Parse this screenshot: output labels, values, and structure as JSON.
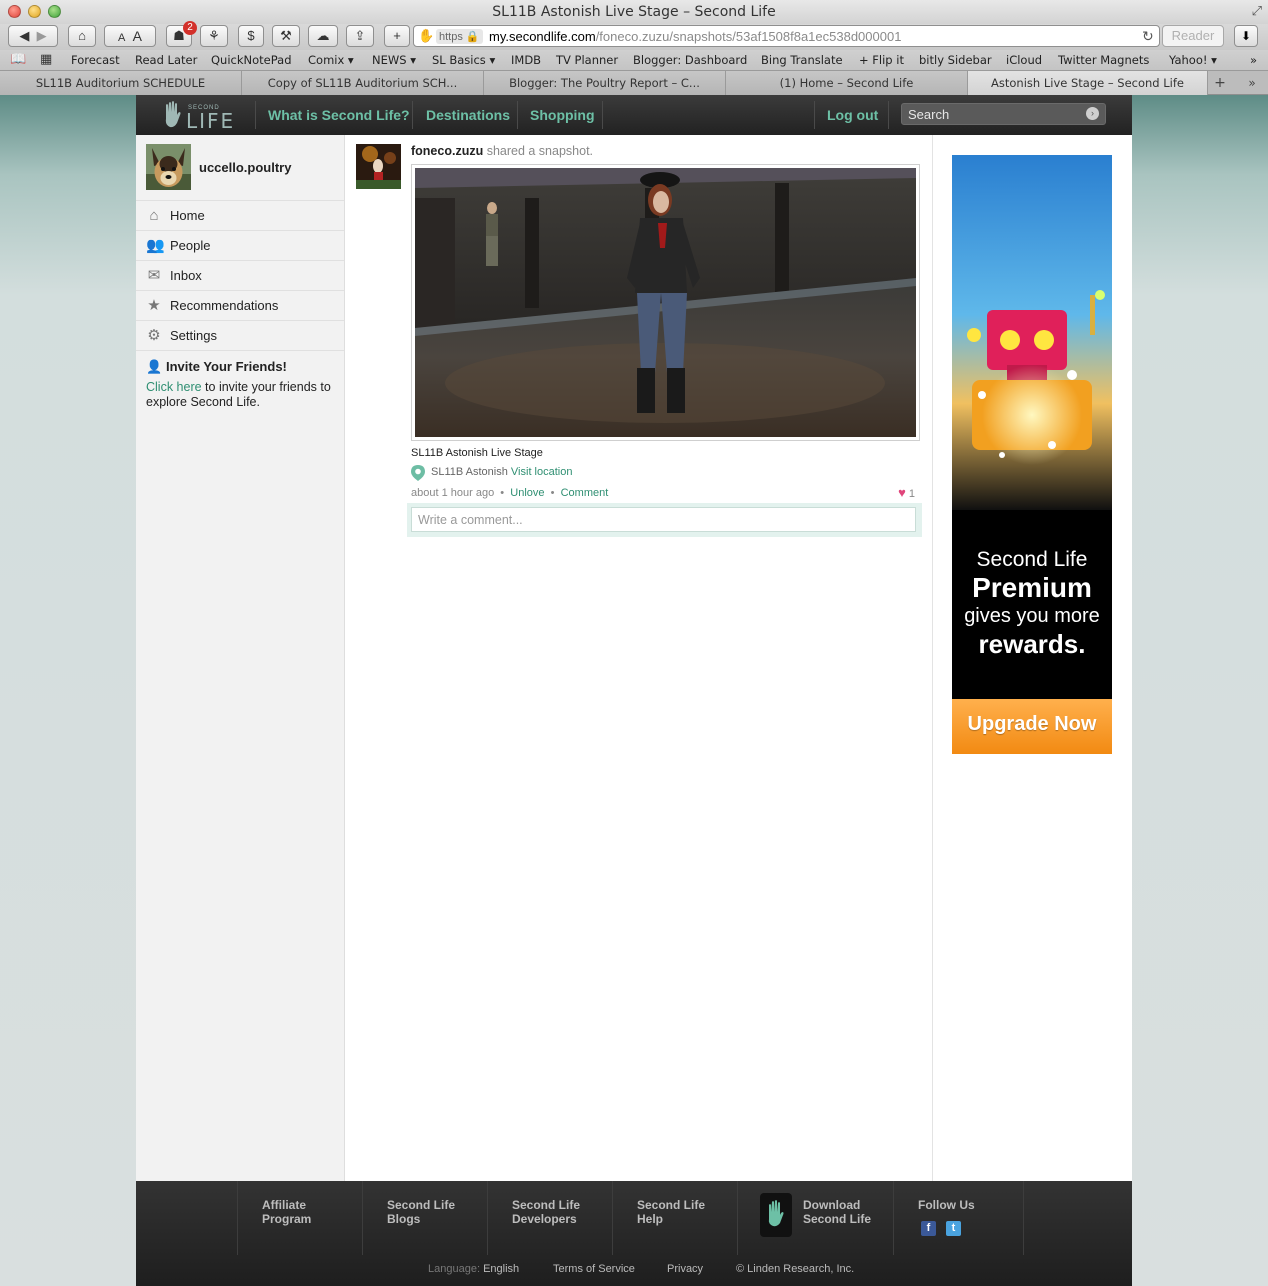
{
  "window": {
    "title": "SL11B Astonish Live Stage – Second Life"
  },
  "toolbar": {
    "font_small": "A",
    "font_large": "A",
    "badge_count": "2",
    "url_scheme": "https",
    "url_host": "my.secondlife.com",
    "url_path": "/foneco.zuzu/snapshots/53af1508f8a1ec538d000001",
    "reader": "Reader"
  },
  "bookmarks": [
    "Forecast",
    "Read Later",
    "QuickNotePad",
    "Comix ▾",
    "NEWS ▾",
    "SL Basics ▾",
    "IMDB",
    "TV Planner",
    "Blogger: Dashboard",
    "Bing Translate",
    "+ Flip it",
    "bitly Sidebar",
    "iCloud",
    "Twitter Magnets",
    "Yahoo! ▾"
  ],
  "tabs": [
    "SL11B Auditorium SCHEDULE",
    "Copy of SL11B Auditorium SCH...",
    "Blogger: The Poultry Report – C...",
    "(1) Home – Second Life",
    "Astonish Live Stage – Second Life"
  ],
  "nav": {
    "logo_small": "SECOND",
    "logo_main": "LIFE",
    "what_is": "What is Second Life?",
    "destinations": "Destinations",
    "shopping": "Shopping",
    "logout": "Log out",
    "search_placeholder": "Search"
  },
  "sidebar": {
    "username": "uccello.poultry",
    "items": [
      {
        "label": "Home",
        "icon": "house-icon"
      },
      {
        "label": "People",
        "icon": "people-icon"
      },
      {
        "label": "Inbox",
        "icon": "envelope-icon"
      },
      {
        "label": "Recommendations",
        "icon": "star-icon"
      },
      {
        "label": "Settings",
        "icon": "gear-icon"
      }
    ],
    "invite_title": "Invite Your Friends!",
    "invite_link": "Click here",
    "invite_text": " to invite your friends to explore Second Life."
  },
  "post": {
    "author": "foneco.zuzu",
    "action": " shared a snapshot.",
    "caption": "SL11B Astonish Live Stage",
    "location": "SL11B Astonish",
    "visit": "Visit location",
    "time": "about 1 hour ago",
    "unlove": "Unlove",
    "comment": "Comment",
    "love_count": "1",
    "comment_placeholder": "Write a comment..."
  },
  "ad": {
    "line1": "Second Life",
    "line2": "Premium",
    "line3": "gives you more",
    "line4": "rewards.",
    "button": "Upgrade Now"
  },
  "footer": {
    "affiliate_1": "Affiliate",
    "affiliate_2": "Program",
    "blogs_1": "Second Life",
    "blogs_2": "Blogs",
    "dev_1": "Second Life",
    "dev_2": "Developers",
    "help_1": "Second Life",
    "help_2": "Help",
    "download_1": "Download",
    "download_2": "Second Life",
    "follow": "Follow Us",
    "language_label": "Language:",
    "language": "English",
    "terms": "Terms of Service",
    "privacy": "Privacy",
    "copyright": "© Linden Research, Inc."
  },
  "colors": {
    "accent": "#6dc0a6",
    "link": "#2f8f72",
    "heart": "#e0457b",
    "upgrade": "#f28a12"
  }
}
